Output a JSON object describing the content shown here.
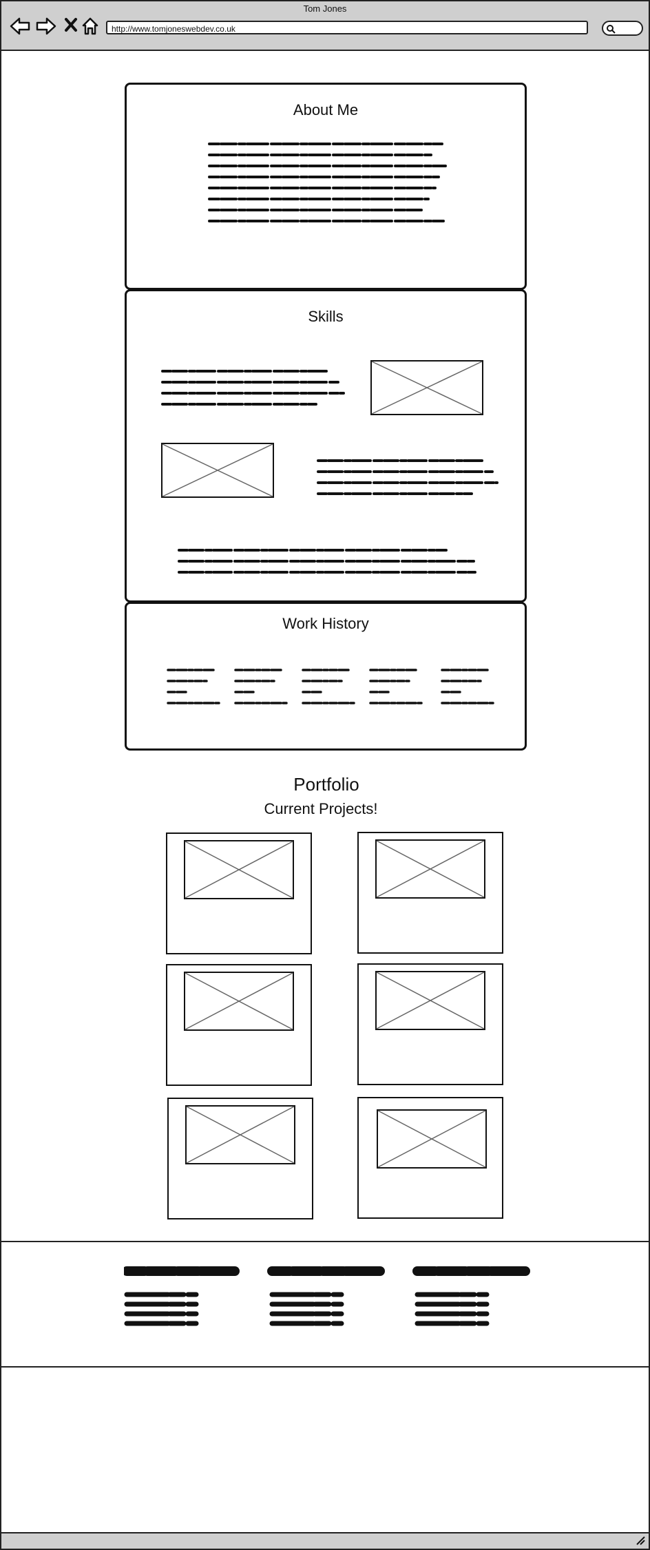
{
  "window": {
    "title": "Tom Jones"
  },
  "address_bar": {
    "url": "http://www.tomjoneswebdev.co.uk"
  },
  "sections": {
    "about": {
      "title": "About Me"
    },
    "skills": {
      "title": "Skills"
    },
    "work": {
      "title": "Work History"
    }
  },
  "portfolio": {
    "title": "Portfolio",
    "subtitle": "Current Projects!"
  },
  "icons": {
    "back": "back-arrow-icon",
    "forward": "forward-arrow-icon",
    "stop": "close-icon",
    "home": "home-icon",
    "search": "search-icon",
    "resize": "resize-grip-icon"
  }
}
